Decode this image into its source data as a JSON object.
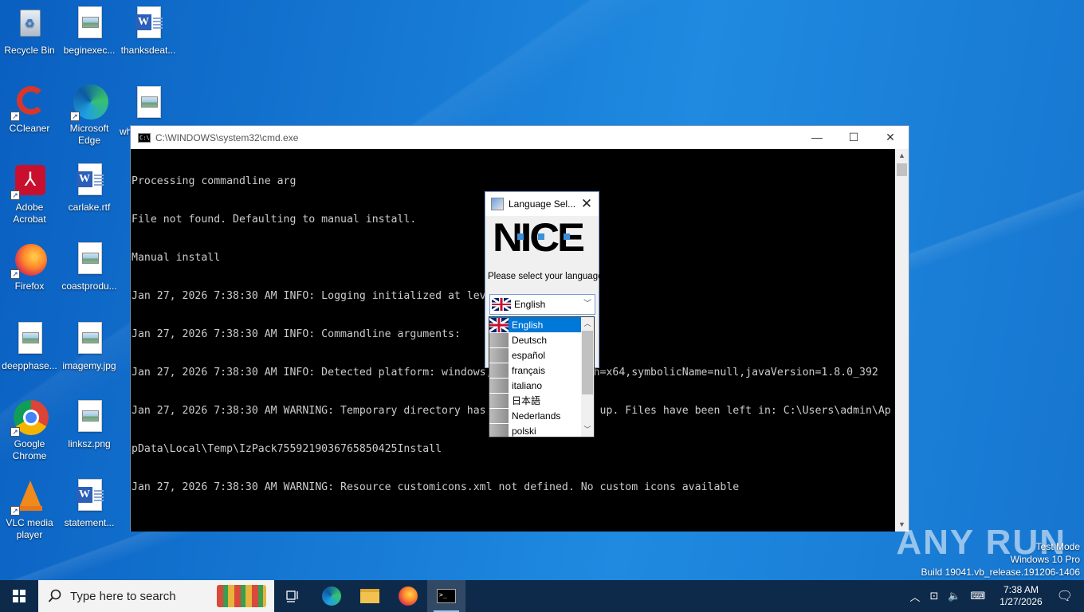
{
  "desktop": {
    "icons": [
      {
        "label": "Recycle Bin"
      },
      {
        "label": "beginexec..."
      },
      {
        "label": "thanksdeat..."
      },
      {
        "label": "CCleaner"
      },
      {
        "label": "Microsoft Edge"
      },
      {
        "label": "wh..."
      },
      {
        "label": "Adobe Acrobat"
      },
      {
        "label": "carlake.rtf"
      },
      {
        "label": "Firefox"
      },
      {
        "label": "coastprodu..."
      },
      {
        "label": "deepphase..."
      },
      {
        "label": "imagemy.jpg"
      },
      {
        "label": "Google Chrome"
      },
      {
        "label": "linksz.png"
      },
      {
        "label": "VLC media player"
      },
      {
        "label": "statement..."
      }
    ]
  },
  "cmd": {
    "title": "C:\\WINDOWS\\system32\\cmd.exe",
    "lines": [
      "Processing commandline arg",
      "File not found. Defaulting to manual install.",
      "Manual install",
      "Jan 27, 2026 7:38:30 AM INFO: Logging initialized at level 'INFO'",
      "Jan 27, 2026 7:38:30 AM INFO: Commandline arguments:",
      "Jan 27, 2026 7:38:30 AM INFO: Detected platform: windows,version=10.0,arch=x64,symbolicName=null,javaVersion=1.8.0_392",
      "Jan 27, 2026 7:38:30 AM WARNING: Temporary directory has not been cleaned up. Files have been left in: C:\\Users\\admin\\Ap",
      "pData\\Local\\Temp\\IzPack7559219036765850425Install",
      "Jan 27, 2026 7:38:30 AM WARNING: Resource customicons.xml not defined. No custom icons available"
    ]
  },
  "language_dialog": {
    "title": "Language Sel...",
    "logo_text": "NICE",
    "prompt": "Please select your language",
    "selected": "English",
    "options": [
      "English",
      "Deutsch",
      "español",
      "français",
      "italiano",
      "日本語",
      "Nederlands",
      "polski"
    ]
  },
  "watermark": "ANY RUN",
  "system_info": {
    "line1": "Test Mode",
    "line2": "Windows 10 Pro",
    "line3": "Build 19041.vb_release.191206-1406"
  },
  "taskbar": {
    "search_placeholder": "Type here to search",
    "time": "7:38 AM",
    "date": "1/27/2026"
  }
}
